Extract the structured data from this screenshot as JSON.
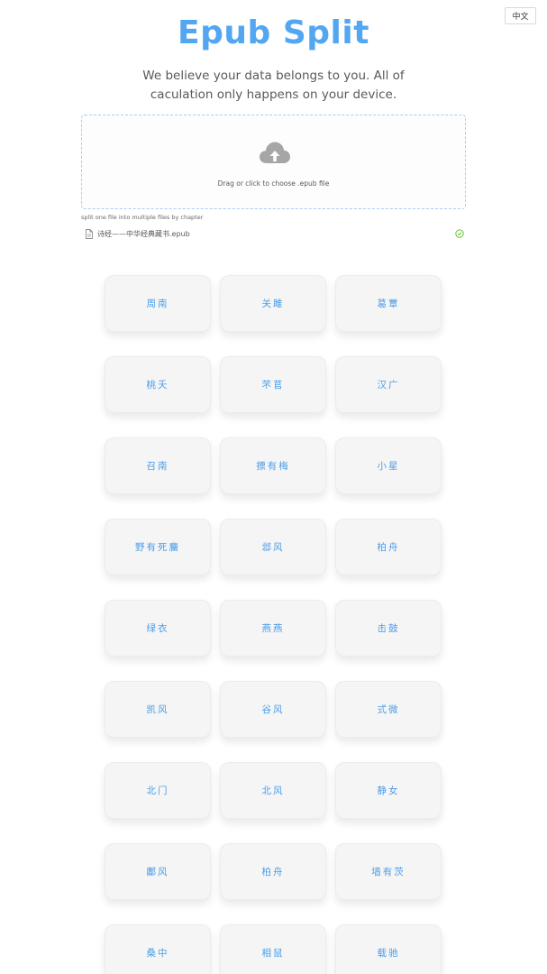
{
  "header": {
    "lang_button": "中文",
    "title": "Epub Split",
    "subtitle": "We believe your data belongs to you. All of caculation only happens on your device."
  },
  "upload": {
    "icon": "cloud-upload-icon",
    "drop_text": "Drag or click to choose .epub file",
    "hint": "split one file into multiple files by chapter",
    "file": {
      "icon": "file-icon",
      "name": "诗经——中华经典藏书.epub",
      "status_icon": "check-circle-icon",
      "status_color": "#52c41a"
    }
  },
  "colors": {
    "accent": "#53a6f1",
    "chapter_text": "#4b9de8",
    "chapter_bg": "#f5f5f5"
  },
  "chapters": [
    "周南",
    "关雎",
    "葛覃",
    "桃夭",
    "芣苢",
    "汉广",
    "召南",
    "摽有梅",
    "小星",
    "野有死麕",
    "邶风",
    "柏舟",
    "绿衣",
    "燕燕",
    "击鼓",
    "凯风",
    "谷风",
    "式微",
    "北门",
    "北风",
    "静女",
    "鄘风",
    "柏舟",
    "墙有茨",
    "桑中",
    "相鼠",
    "载驰"
  ]
}
